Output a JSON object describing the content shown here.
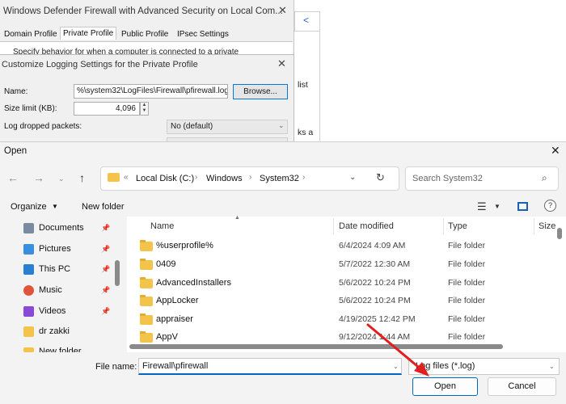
{
  "bg_window": {
    "title": "Windows Defender Firewall with Advanced Security on Local Com...",
    "tabs": [
      "Domain Profile",
      "Private Profile",
      "Public Profile",
      "IPsec Settings"
    ],
    "description": "Specify behavior for when a computer is connected to a private",
    "right_fragment_1": "list",
    "right_fragment_2": "ks a"
  },
  "logging_dialog": {
    "title": "Customize Logging Settings for the Private Profile",
    "name_label": "Name:",
    "name_value": "%\\system32\\LogFiles\\Firewall\\pfirewall.log",
    "browse_label": "Browse...",
    "size_label": "Size limit (KB):",
    "size_value": "4,096",
    "dropped_label": "Log dropped packets:",
    "dropped_value": "No (default)"
  },
  "open_dialog": {
    "title": "Open",
    "breadcrumb": [
      "Local Disk (C:)",
      "Windows",
      "System32"
    ],
    "search_placeholder": "Search System32",
    "toolbar": {
      "organize": "Organize",
      "new_folder": "New folder"
    },
    "nav_items": [
      "Documents",
      "Pictures",
      "This PC",
      "Music",
      "Videos",
      "dr zakki",
      "New folder"
    ],
    "columns": [
      "Name",
      "Date modified",
      "Type",
      "Size"
    ],
    "rows": [
      {
        "name": "%userprofile%",
        "date": "6/4/2024 4:09 AM",
        "type": "File folder"
      },
      {
        "name": "0409",
        "date": "5/7/2022 12:30 AM",
        "type": "File folder"
      },
      {
        "name": "AdvancedInstallers",
        "date": "5/6/2022 10:24 PM",
        "type": "File folder"
      },
      {
        "name": "AppLocker",
        "date": "5/6/2022 10:24 PM",
        "type": "File folder"
      },
      {
        "name": "appraiser",
        "date": "4/19/2025 12:42 PM",
        "type": "File folder"
      },
      {
        "name": "AppV",
        "date": "9/12/2024 1:44 AM",
        "type": "File folder"
      }
    ],
    "file_name_label": "File name:",
    "file_name_value": "Firewall\\pfirewall",
    "file_type_value": "Log files (*.log)",
    "open_label": "Open",
    "cancel_label": "Cancel"
  },
  "colors": {
    "accent": "#0067c0",
    "folder": "#f3c34a",
    "annotation_arrow": "#e02020"
  }
}
